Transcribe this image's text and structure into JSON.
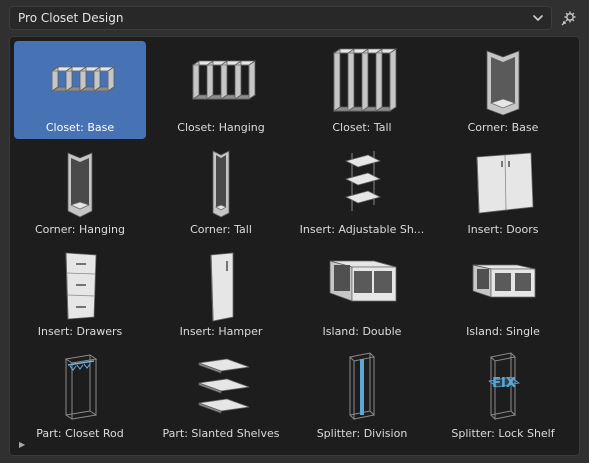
{
  "library": {
    "selected": "Pro Closet Design"
  },
  "items": [
    {
      "label": "Closet: Base",
      "icon": "closet-base-icon",
      "selected": true
    },
    {
      "label": "Closet: Hanging",
      "icon": "closet-hanging-icon"
    },
    {
      "label": "Closet: Tall",
      "icon": "closet-tall-icon"
    },
    {
      "label": "Corner: Base",
      "icon": "corner-base-icon"
    },
    {
      "label": "Corner: Hanging",
      "icon": "corner-hanging-icon"
    },
    {
      "label": "Corner: Tall",
      "icon": "corner-tall-icon"
    },
    {
      "label": "Insert: Adjustable Sh...",
      "icon": "adjustable-shelves-icon"
    },
    {
      "label": "Insert: Doors",
      "icon": "doors-icon"
    },
    {
      "label": "Insert: Drawers",
      "icon": "drawers-icon"
    },
    {
      "label": "Insert: Hamper",
      "icon": "hamper-icon"
    },
    {
      "label": "Island: Double",
      "icon": "island-double-icon"
    },
    {
      "label": "Island: Single",
      "icon": "island-single-icon"
    },
    {
      "label": "Part: Closet Rod",
      "icon": "closet-rod-icon"
    },
    {
      "label": "Part: Slanted Shelves",
      "icon": "slanted-shelves-icon"
    },
    {
      "label": "Splitter: Division",
      "icon": "splitter-division-icon"
    },
    {
      "label": "Splitter: Lock Shelf",
      "icon": "splitter-lock-shelf-icon",
      "thumb_text": "FIX"
    }
  ],
  "colors": {
    "selection": "#4772b3",
    "panel": "#1d1d1d",
    "background": "#303030"
  }
}
